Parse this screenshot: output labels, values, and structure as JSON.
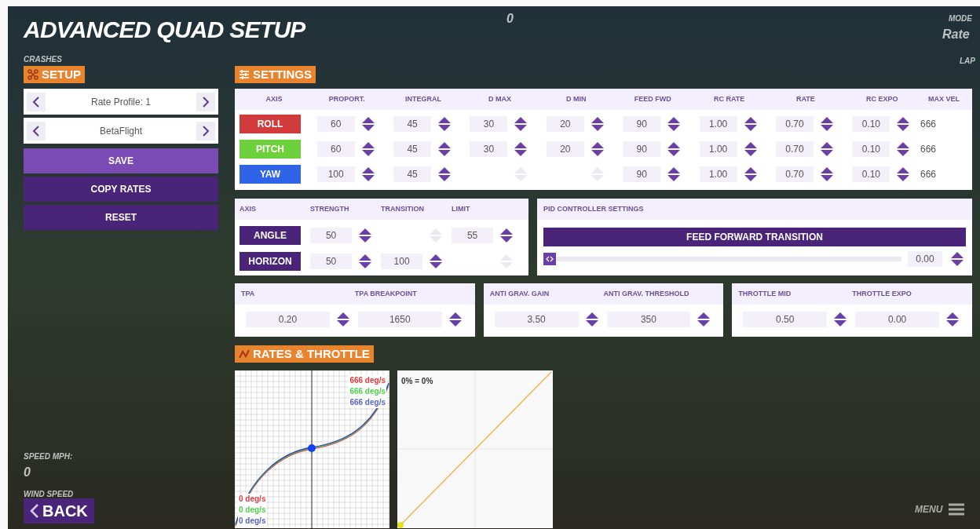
{
  "title": "ADVANCED QUAD SETUP",
  "hud": [
    {
      "kind": "counter",
      "text": "0"
    },
    {
      "kind": "mode_label",
      "text": "MODE"
    },
    {
      "kind": "mode_value",
      "text": "Rate"
    },
    {
      "kind": "crashes",
      "text": "CRASHES"
    },
    {
      "kind": "lap",
      "text": "LAP"
    },
    {
      "kind": "speed_label",
      "text": "SPEED MPH:"
    },
    {
      "kind": "speed_value",
      "text": "0"
    },
    {
      "kind": "wind",
      "text": "WIND SPEED"
    }
  ],
  "setup": {
    "heading": "SETUP",
    "selectors": [
      {
        "value": "Rate Profile: 1"
      },
      {
        "value": "BetaFlight"
      }
    ],
    "buttons": [
      {
        "label": "SAVE",
        "kind": "primary"
      },
      {
        "label": "COPY RATES",
        "kind": "secondary"
      },
      {
        "label": "RESET",
        "kind": "secondary"
      }
    ]
  },
  "settings": {
    "heading": "SETTINGS",
    "axis_header": "AXIS",
    "columns": [
      "PROPORT.",
      "INTEGRAL",
      "D MAX",
      "D MIN",
      "FEED FWD",
      "RC RATE",
      "RATE",
      "RC EXPO",
      "MAX VEL"
    ],
    "rows": [
      {
        "axis": "ROLL",
        "color": "#d23b3b",
        "cells": [
          {
            "value": "60",
            "disabled": false
          },
          {
            "value": "45",
            "disabled": false
          },
          {
            "value": "30",
            "disabled": false
          },
          {
            "value": "20",
            "disabled": false
          },
          {
            "value": "90",
            "disabled": false
          },
          {
            "value": "1.00",
            "disabled": false
          },
          {
            "value": "0.70",
            "disabled": false
          },
          {
            "value": "0.10",
            "disabled": false
          }
        ],
        "max_vel": "666"
      },
      {
        "axis": "PITCH",
        "color": "#6cd13a",
        "cells": [
          {
            "value": "60",
            "disabled": false
          },
          {
            "value": "45",
            "disabled": false
          },
          {
            "value": "30",
            "disabled": false
          },
          {
            "value": "20",
            "disabled": false
          },
          {
            "value": "90",
            "disabled": false
          },
          {
            "value": "1.00",
            "disabled": false
          },
          {
            "value": "0.70",
            "disabled": false
          },
          {
            "value": "0.10",
            "disabled": false
          }
        ],
        "max_vel": "666"
      },
      {
        "axis": "YAW",
        "color": "#2f63e8",
        "cells": [
          {
            "value": "100",
            "disabled": false
          },
          {
            "value": "45",
            "disabled": false
          },
          {
            "disabled": true
          },
          {
            "disabled": true
          },
          {
            "value": "90",
            "disabled": false
          },
          {
            "value": "1.00",
            "disabled": false
          },
          {
            "value": "0.70",
            "disabled": false
          },
          {
            "value": "0.10",
            "disabled": false
          }
        ],
        "max_vel": "666"
      }
    ]
  },
  "modes": {
    "axis_header": "AXIS",
    "columns": [
      "STRENGTH",
      "TRANSITION",
      "LIMIT"
    ],
    "rows": [
      {
        "axis": "ANGLE",
        "cells": [
          {
            "value": "50",
            "disabled": false
          },
          {
            "disabled": true
          },
          {
            "value": "55",
            "disabled": false
          }
        ]
      },
      {
        "axis": "HORIZON",
        "cells": [
          {
            "value": "50",
            "disabled": false
          },
          {
            "value": "100",
            "disabled": false
          },
          {
            "disabled": true
          }
        ]
      }
    ]
  },
  "pid": {
    "heading": "PID CONTROLLER SETTINGS",
    "button": "FEED FORWARD TRANSITION",
    "slider": {
      "level": 0
    },
    "value": "0.00"
  },
  "groups": [
    {
      "fields": [
        {
          "label": "TPA",
          "value": "0.20"
        },
        {
          "label": "TPA BREAKPOINT",
          "value": "1650"
        }
      ]
    },
    {
      "fields": [
        {
          "label": "ANTI GRAV. GAIN",
          "value": "3.50"
        },
        {
          "label": "ANTI GRAV. THRESHOLD",
          "value": "350"
        }
      ]
    },
    {
      "fields": [
        {
          "label": "THROTTLE MID",
          "value": "0.50"
        },
        {
          "label": "THROTTLE EXPO",
          "value": "0.00"
        }
      ]
    }
  ],
  "rates": {
    "heading": "RATES & THROTTLE",
    "max_labels": [
      {
        "text": "666 deg/s",
        "color": "#e8383d"
      },
      {
        "text": "666 deg/s",
        "color": "#4fd24a"
      },
      {
        "text": "666 deg/s",
        "color": "#5a62c8"
      }
    ],
    "min_labels": [
      {
        "text": "0 deg/s",
        "color": "#e8383d"
      },
      {
        "text": "0 deg/s",
        "color": "#4fd24a"
      },
      {
        "text": "0 deg/s",
        "color": "#5a62c8"
      }
    ],
    "throttle_label": "0% = 0%"
  },
  "back": "BACK",
  "menu": "MENU"
}
